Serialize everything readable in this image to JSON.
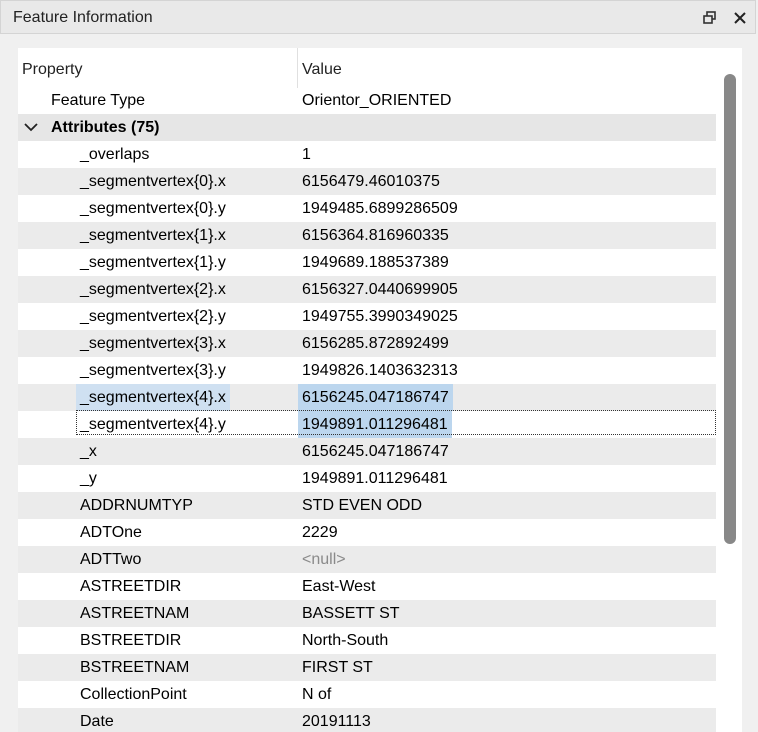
{
  "window": {
    "title": "Feature Information",
    "restore_icon": "restore-window-icon",
    "close_icon": "close-icon"
  },
  "table": {
    "headers": {
      "property": "Property",
      "value": "Value"
    },
    "feature_type": {
      "label": "Feature Type",
      "value": "Orientor_ORIENTED"
    },
    "group": {
      "label": "Attributes (75)",
      "icon": "chevron-down-icon"
    },
    "rows": [
      {
        "p": "_overlaps",
        "v": "1"
      },
      {
        "p": "_segmentvertex{0}.x",
        "v": "6156479.46010375"
      },
      {
        "p": "_segmentvertex{0}.y",
        "v": "1949485.6899286509"
      },
      {
        "p": "_segmentvertex{1}.x",
        "v": "6156364.816960335"
      },
      {
        "p": "_segmentvertex{1}.y",
        "v": "1949689.188537389"
      },
      {
        "p": "_segmentvertex{2}.x",
        "v": "6156327.0440699905"
      },
      {
        "p": "_segmentvertex{2}.y",
        "v": "1949755.3990349025"
      },
      {
        "p": "_segmentvertex{3}.x",
        "v": "6156285.872892499"
      },
      {
        "p": "_segmentvertex{3}.y",
        "v": "1949826.1403632313"
      },
      {
        "p": "_segmentvertex{4}.x",
        "v": "6156245.047186747"
      },
      {
        "p": "_segmentvertex{4}.y",
        "v": "1949891.011296481"
      },
      {
        "p": "_x",
        "v": "6156245.047186747"
      },
      {
        "p": "_y",
        "v": "1949891.011296481"
      },
      {
        "p": "ADDRNUMTYP",
        "v": "STD EVEN ODD"
      },
      {
        "p": "ADTOne",
        "v": "2229"
      },
      {
        "p": "ADTTwo",
        "v": "<null>"
      },
      {
        "p": "ASTREETDIR",
        "v": "East-West"
      },
      {
        "p": "ASTREETNAM",
        "v": "BASSETT ST"
      },
      {
        "p": "BSTREETDIR",
        "v": "North-South"
      },
      {
        "p": "BSTREETNAM",
        "v": "FIRST ST"
      },
      {
        "p": "CollectionPoint",
        "v": "N of"
      },
      {
        "p": "Date",
        "v": "20191113"
      }
    ]
  },
  "colors": {
    "selection": "#bcd6ee",
    "alt_row": "#ebebeb",
    "null_text": "#8a8a8a"
  }
}
